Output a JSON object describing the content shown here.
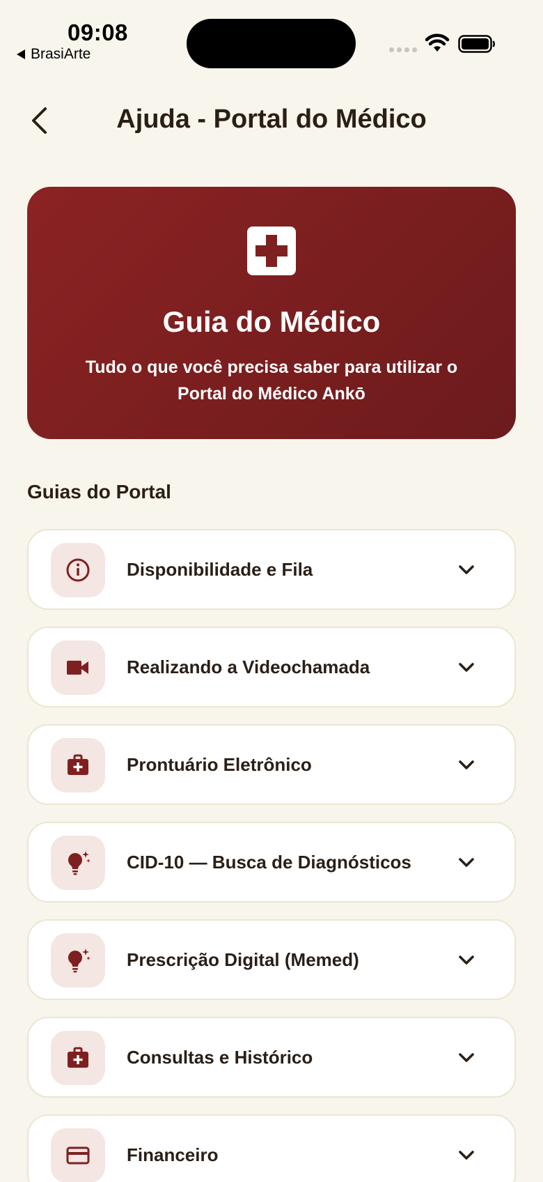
{
  "status_bar": {
    "time": "09:08",
    "back_app": "BrasiArte"
  },
  "header": {
    "title": "Ajuda - Portal do Médico",
    "back_icon": "chevron-left-icon"
  },
  "hero": {
    "icon": "medical-cross-icon",
    "title": "Guia do Médico",
    "subtitle": "Tudo o que você precisa saber para utilizar o Portal do Médico Ankō"
  },
  "section": {
    "title": "Guias do Portal"
  },
  "guides": [
    {
      "label": "Disponibilidade e Fila",
      "icon": "info-icon"
    },
    {
      "label": "Realizando a Videochamada",
      "icon": "video-camera-icon"
    },
    {
      "label": "Prontuário Eletrônico",
      "icon": "medical-kit-icon"
    },
    {
      "label": "CID-10 — Busca de Diagnósticos",
      "icon": "lightbulb-sparkle-icon"
    },
    {
      "label": "Prescrição Digital (Memed)",
      "icon": "lightbulb-sparkle-icon"
    },
    {
      "label": "Consultas e Histórico",
      "icon": "medical-kit-icon"
    },
    {
      "label": "Financeiro",
      "icon": "credit-card-icon"
    }
  ],
  "colors": {
    "background": "#f8f5ec",
    "accent": "#7f2020",
    "icon_tile": "#f3e6e3",
    "text": "#2a1f17"
  }
}
